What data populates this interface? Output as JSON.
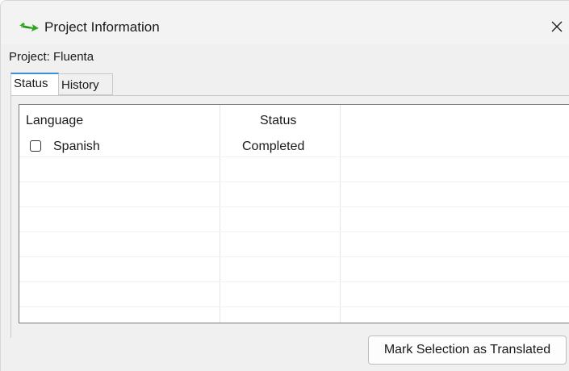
{
  "window": {
    "title": "Project Information",
    "icon": "arrow-app-icon",
    "close_icon": "close-icon"
  },
  "project": {
    "label": "Project: Fluenta"
  },
  "tabs": [
    {
      "label": "Status",
      "selected": true
    },
    {
      "label": "History",
      "selected": false
    }
  ],
  "table": {
    "columns": [
      "Language",
      "Status",
      ""
    ],
    "rows": [
      {
        "checked": false,
        "language": "Spanish",
        "status": "Completed"
      }
    ]
  },
  "actions": {
    "mark_translated_label": "Mark Selection as Translated"
  },
  "colors": {
    "accent": "#3b8fd9",
    "icon_green": "#2fa81f"
  }
}
